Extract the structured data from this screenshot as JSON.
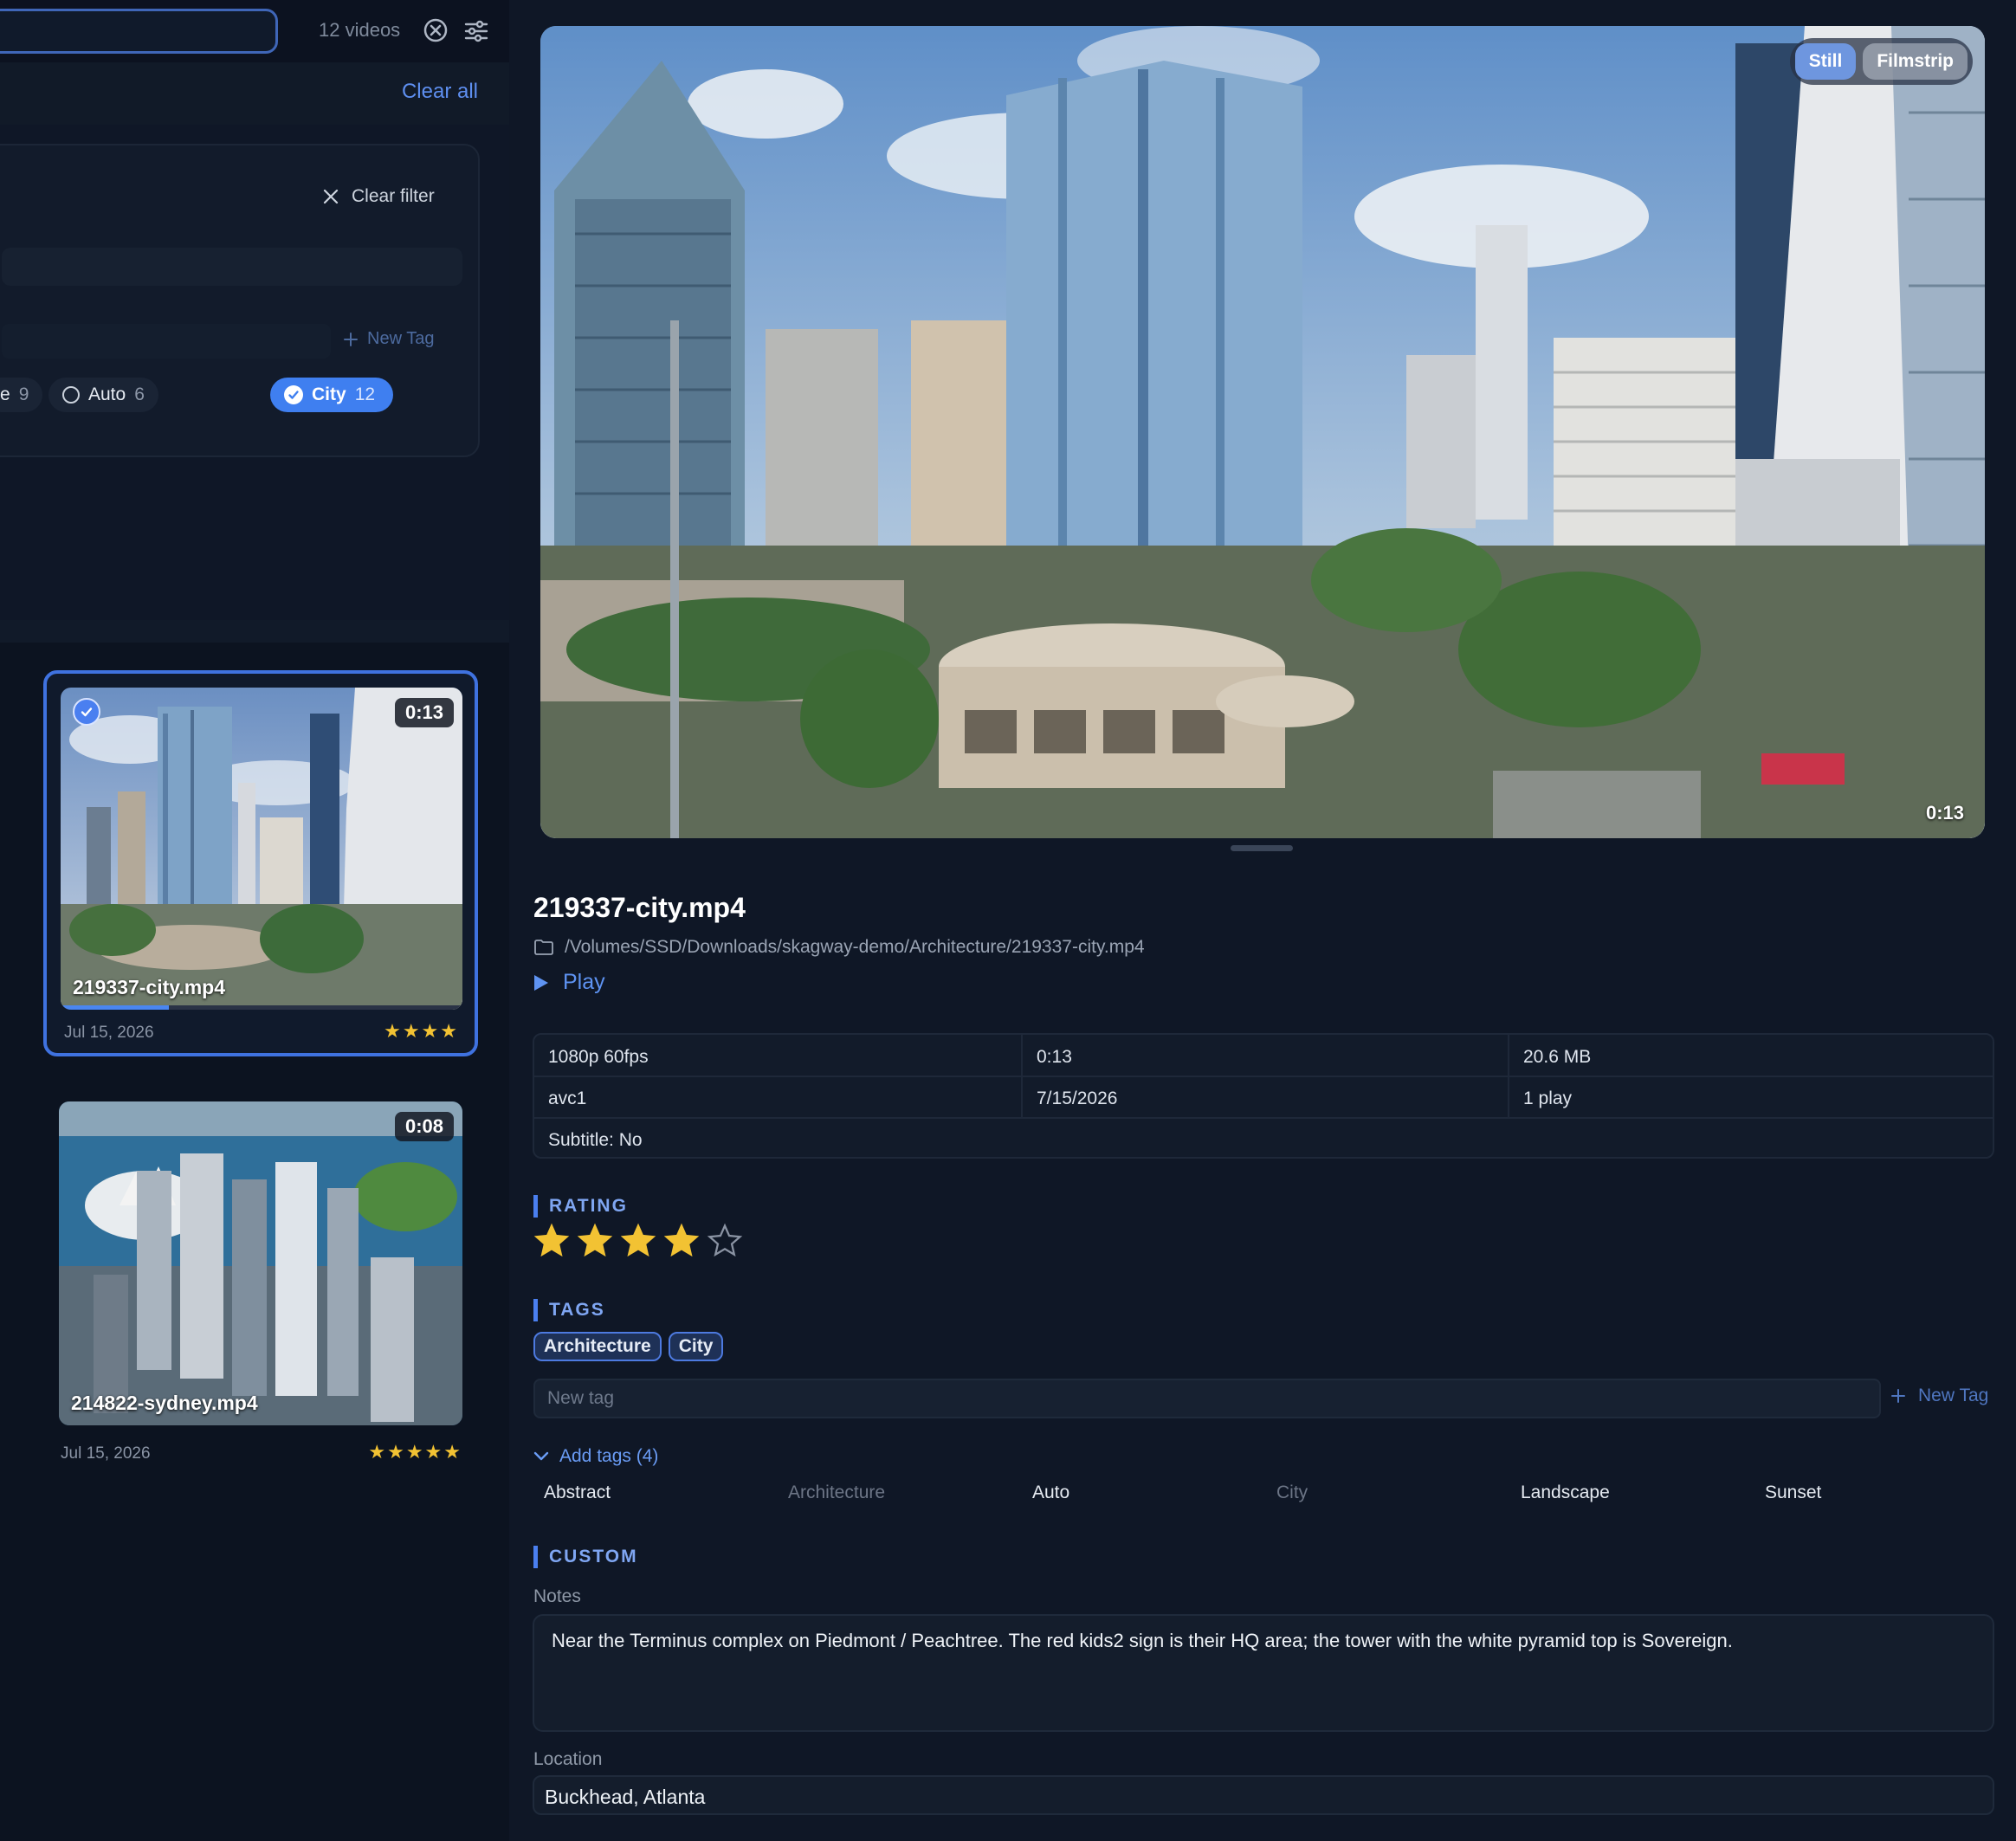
{
  "toolbar": {
    "video_count": "12 videos",
    "clear_all": "Clear all"
  },
  "filter": {
    "clear_filter": "Clear filter",
    "new_tag": "New Tag",
    "chips": [
      {
        "label": "e",
        "count": "9"
      },
      {
        "label": "Auto",
        "count": "6"
      },
      {
        "label": "City",
        "count": "12",
        "selected": true
      }
    ]
  },
  "grid": {
    "cards": [
      {
        "name": "219337-city.mp4",
        "duration": "0:13",
        "date": "Jul 15, 2026",
        "stars": "★★★★",
        "selected": true,
        "progress_fraction": 0.27
      },
      {
        "name": "214822-sydney.mp4",
        "duration": "0:08",
        "date": "Jul 15, 2026",
        "stars": "★★★★★",
        "selected": false
      }
    ]
  },
  "preview": {
    "toggle_still": "Still",
    "toggle_filmstrip": "Filmstrip",
    "active_view": "Still",
    "duration": "0:13"
  },
  "detail": {
    "title": "219337-city.mp4",
    "path": "/Volumes/SSD/Downloads/skagway-demo/Architecture/219337-city.mp4",
    "play": "Play",
    "meta": {
      "resolution": "1080p 60fps",
      "duration": "0:13",
      "size": "20.6 MB",
      "codec": "avc1",
      "date": "7/15/2026",
      "plays": "1 play",
      "subtitle": "Subtitle: No"
    },
    "rating_label": "RATING",
    "rating_value": 4,
    "rating_max": 5,
    "tags_label": "TAGS",
    "tags": [
      "Architecture",
      "City"
    ],
    "new_tag_placeholder": "New tag",
    "new_tag_button": "New Tag",
    "add_tags": "Add tags (4)",
    "suggested_tags": [
      {
        "label": "Abstract",
        "enabled": true
      },
      {
        "label": "Architecture",
        "enabled": false
      },
      {
        "label": "Auto",
        "enabled": true
      },
      {
        "label": "City",
        "enabled": false
      },
      {
        "label": "Landscape",
        "enabled": true
      },
      {
        "label": "Sunset",
        "enabled": true
      }
    ],
    "custom_label": "CUSTOM",
    "notes_label": "Notes",
    "notes": "Near the Terminus complex on Piedmont / Peachtree. The red kids2 sign is their HQ area; the tower with the white pyramid top is Sovereign.",
    "location_label": "Location",
    "location": "Buckhead, Atlanta"
  },
  "colors": {
    "accent": "#4a7ff0",
    "star": "#f2c233",
    "background": "#0f1726"
  }
}
